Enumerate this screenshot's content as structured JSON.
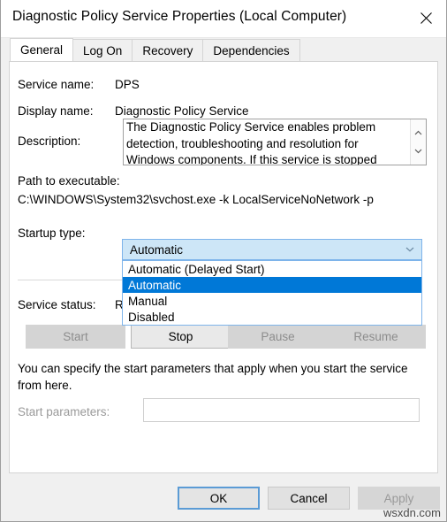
{
  "window": {
    "title": "Diagnostic Policy Service Properties (Local Computer)",
    "close_icon": "close-icon"
  },
  "tabs": [
    {
      "label": "General",
      "active": true
    },
    {
      "label": "Log On",
      "active": false
    },
    {
      "label": "Recovery",
      "active": false
    },
    {
      "label": "Dependencies",
      "active": false
    }
  ],
  "general": {
    "service_name_label": "Service name:",
    "service_name_value": "DPS",
    "display_name_label": "Display name:",
    "display_name_value": "Diagnostic Policy Service",
    "description_label": "Description:",
    "description_value": "The Diagnostic Policy Service enables problem detection, troubleshooting and resolution for Windows components. If this service is stopped",
    "path_label": "Path to executable:",
    "path_value": "C:\\WINDOWS\\System32\\svchost.exe -k LocalServiceNoNetwork -p",
    "startup_type_label": "Startup type:",
    "startup_type_value": "Automatic",
    "startup_type_options": [
      "Automatic (Delayed Start)",
      "Automatic",
      "Manual",
      "Disabled"
    ],
    "startup_type_selected_index": 1,
    "service_status_label": "Service status:",
    "service_status_value": "Running",
    "buttons": [
      {
        "label": "Start",
        "enabled": false
      },
      {
        "label": "Stop",
        "enabled": true
      },
      {
        "label": "Pause",
        "enabled": false
      },
      {
        "label": "Resume",
        "enabled": false
      }
    ],
    "hint_text": "You can specify the start parameters that apply when you start the service from here.",
    "start_parameters_label": "Start parameters:",
    "start_parameters_value": "",
    "start_parameters_enabled": false
  },
  "footer": {
    "ok_label": "OK",
    "cancel_label": "Cancel",
    "apply_label": "Apply",
    "apply_enabled": false
  },
  "watermark": "wsxdn.com",
  "colors": {
    "accent_selection": "#0078d7",
    "combo_open_fill": "#cde6f7",
    "focus_border": "#5b9bd5",
    "dialog_bg": "#f0f0f0"
  }
}
